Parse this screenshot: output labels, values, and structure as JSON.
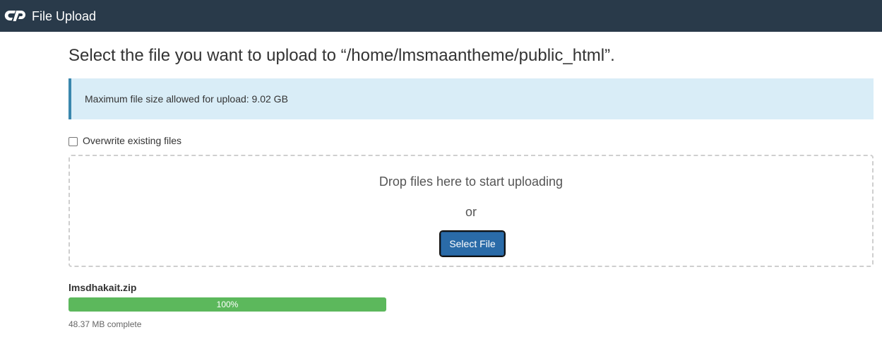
{
  "app": {
    "title": "File Upload",
    "logo_icon": "cpanel-logo-icon"
  },
  "page": {
    "heading": "Select the file you want to upload to “/home/lmsmaantheme/public_html”.",
    "info": "Maximum file size allowed for upload: 9.02 GB"
  },
  "options": {
    "overwrite_label": "Overwrite existing files",
    "overwrite_checked": false
  },
  "dropzone": {
    "prompt": "Drop files here to start uploading",
    "or": "or",
    "select_button": "Select File"
  },
  "upload": {
    "file_name": "lmsdhakait.zip",
    "progress_label": "100%",
    "progress_fraction": 1.0,
    "status": "48.37 MB complete"
  },
  "colors": {
    "topbar": "#293a4a",
    "info_bg": "#d9edf7",
    "info_accent": "#3a87ad",
    "primary_button": "#2a6ba8",
    "progress": "#5cb85c"
  }
}
